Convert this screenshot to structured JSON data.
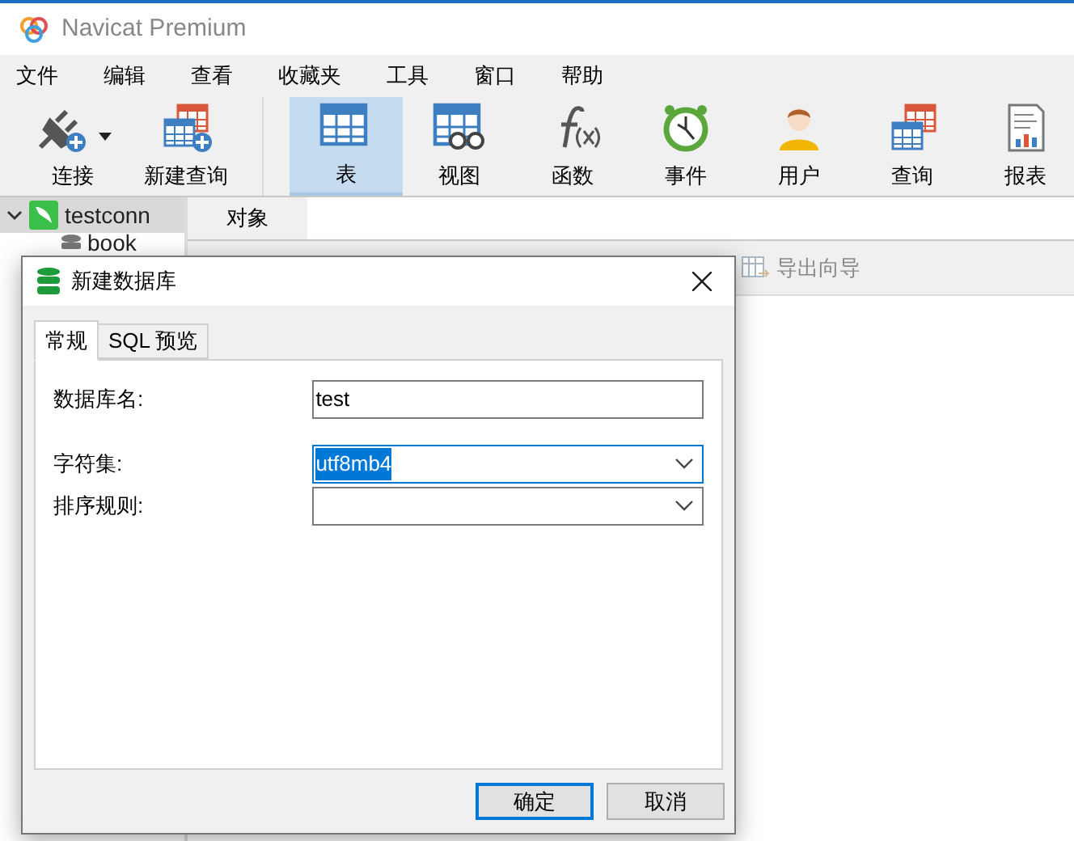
{
  "window": {
    "title": "Navicat Premium"
  },
  "menu": [
    "文件",
    "编辑",
    "查看",
    "收藏夹",
    "工具",
    "窗口",
    "帮助"
  ],
  "toolbar_groups": [
    [
      {
        "label": "连接",
        "kind": "connect",
        "selected": false,
        "dropdown": true
      },
      {
        "label": "新建查询",
        "kind": "new-query",
        "selected": false,
        "dropdown": false
      }
    ],
    [
      {
        "label": "表",
        "kind": "table",
        "selected": true,
        "dropdown": false
      },
      {
        "label": "视图",
        "kind": "view",
        "selected": false,
        "dropdown": false
      },
      {
        "label": "函数",
        "kind": "function",
        "selected": false,
        "dropdown": false
      },
      {
        "label": "事件",
        "kind": "event",
        "selected": false,
        "dropdown": false
      },
      {
        "label": "用户",
        "kind": "user",
        "selected": false,
        "dropdown": false
      },
      {
        "label": "查询",
        "kind": "query",
        "selected": false,
        "dropdown": false
      },
      {
        "label": "报表",
        "kind": "report",
        "selected": false,
        "dropdown": false
      }
    ]
  ],
  "tree": [
    {
      "label": "testconn",
      "expanded": true,
      "selected": true,
      "children": [
        {
          "label": "book",
          "selected": false
        }
      ]
    }
  ],
  "object_tabs": [
    {
      "label": "对象",
      "selected": true
    }
  ],
  "object_toolbar": [
    {
      "label": "导出向导",
      "disabled": true
    }
  ],
  "dialog": {
    "title": "新建数据库",
    "tabs": [
      {
        "label": "常规",
        "selected": true
      },
      {
        "label": "SQL 预览",
        "selected": false
      }
    ],
    "fields": [
      {
        "label": "数据库名:",
        "kind": "text",
        "value": "test",
        "focused": false
      },
      {
        "label": "字符集:",
        "kind": "select",
        "value": "utf8mb4",
        "focused": true
      },
      {
        "label": "排序规则:",
        "kind": "select",
        "focused": false
      }
    ],
    "buttons": [
      {
        "label": "确定",
        "default": true
      },
      {
        "label": "取消",
        "default": false
      }
    ]
  }
}
